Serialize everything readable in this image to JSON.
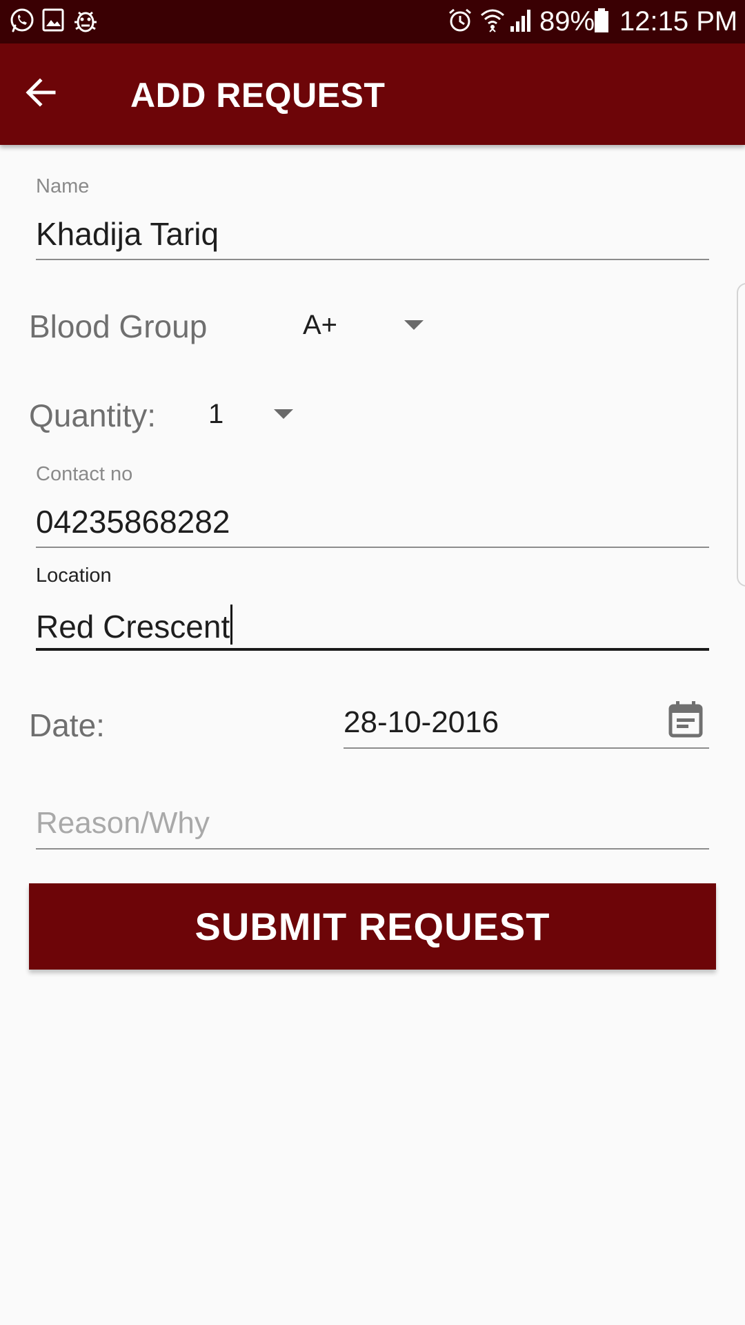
{
  "status_bar": {
    "battery": "89%",
    "time": "12:15 PM",
    "left_icons": [
      "whatsapp-icon",
      "gallery-icon",
      "bug-icon"
    ],
    "right_icons": [
      "alarm-icon",
      "wifi-icon",
      "signal-icon",
      "battery-icon"
    ]
  },
  "toolbar": {
    "title": "ADD REQUEST",
    "back_icon": "arrow-back-icon",
    "background": "#6d0508"
  },
  "form": {
    "name": {
      "label": "Name",
      "value": "Khadija Tariq"
    },
    "blood_group": {
      "label": "Blood Group",
      "selected": "A+"
    },
    "quantity": {
      "label": "Quantity:",
      "selected": "1"
    },
    "contact": {
      "label": "Contact no",
      "value": "04235868282"
    },
    "location": {
      "label": "Location",
      "value": "Red Crescent"
    },
    "date": {
      "label": "Date:",
      "value": "28-10-2016",
      "icon": "calendar-icon"
    },
    "reason": {
      "placeholder": "Reason/Why",
      "value": ""
    }
  },
  "submit_label": "SUBMIT REQUEST",
  "colors": {
    "primary": "#6d0508",
    "status_bar": "#3a0003",
    "background": "#fafafa"
  }
}
